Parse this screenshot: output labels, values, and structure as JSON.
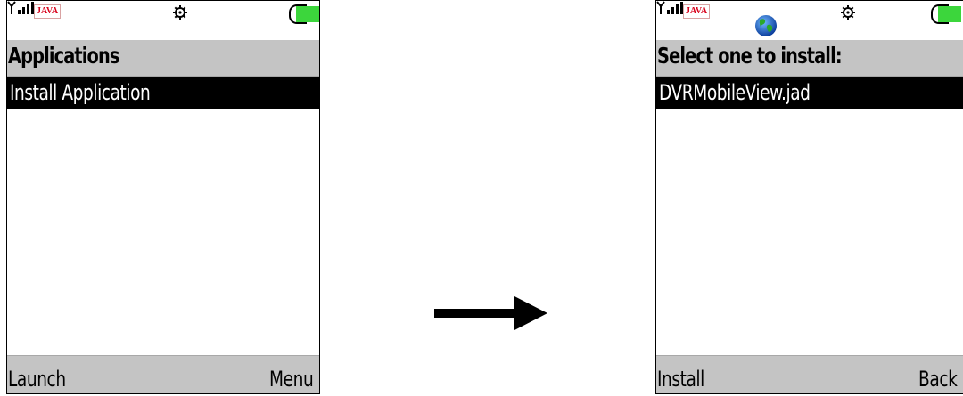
{
  "left_screen": {
    "status": {
      "java_label": "JAVA",
      "icons": [
        "signal-icon",
        "java-icon",
        "settings-icon",
        "battery-icon"
      ]
    },
    "title": "Applications",
    "list_items": [
      "Install Application"
    ],
    "soft_left": "Launch",
    "soft_right": "Menu"
  },
  "right_screen": {
    "status": {
      "java_label": "JAVA",
      "icons": [
        "signal-icon",
        "java-icon",
        "globe-icon",
        "settings-icon",
        "battery-icon"
      ]
    },
    "title": "Select one to install:",
    "list_items": [
      "DVRMobileView.jad"
    ],
    "soft_left": "Install",
    "soft_right": "Back"
  },
  "transition": {
    "icon": "right-arrow-icon"
  },
  "colors": {
    "title_bar": "#c4c4c4",
    "selection": "#000000",
    "battery_fill": "#3cd63c",
    "java_text": "#d8001a"
  }
}
